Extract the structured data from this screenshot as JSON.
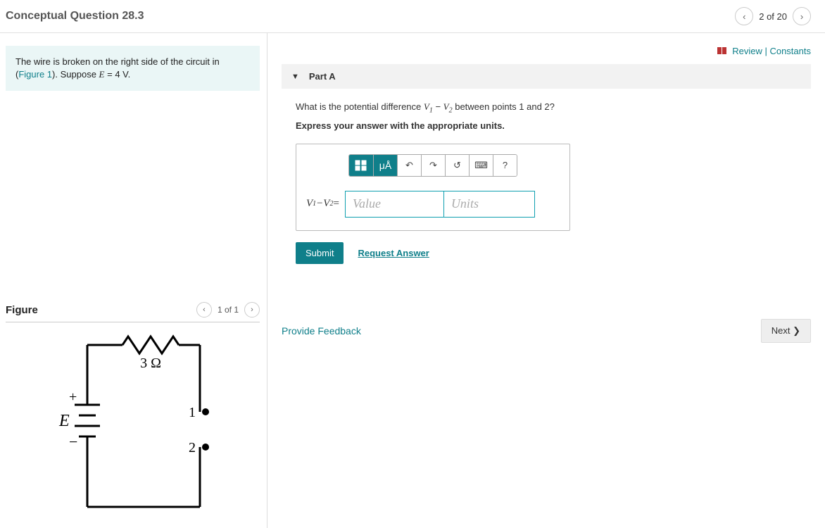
{
  "header": {
    "title": "Conceptual Question 28.3",
    "pager_text": "2 of 20"
  },
  "problem": {
    "text_before_link": "The wire is broken on the right side of the circuit in (",
    "figure_link": "Figure 1",
    "text_after_link": "). Suppose ",
    "emf_symbol": "E",
    "emf_value": " = 4 V",
    "period": "."
  },
  "figure": {
    "title": "Figure",
    "pager": "1 of 1",
    "resistor_label": "3 Ω",
    "emf_label": "E",
    "plus": "+",
    "minus": "−",
    "node1": "1",
    "node2": "2"
  },
  "toplinks": {
    "review": "Review",
    "sep": " | ",
    "constants": "Constants"
  },
  "part": {
    "label": "Part A",
    "question_pre": "What is the potential difference ",
    "v1": "V",
    "sub1": "1",
    "minus": " − ",
    "v2": "V",
    "sub2": "2",
    "question_post": " between points 1 and 2?",
    "instruction": "Express your answer with the appropriate units.",
    "toolbar": {
      "templates": "▫▫",
      "units_btn": "μÅ",
      "undo": "↶",
      "redo": "↷",
      "reset": "↺",
      "keyboard": "⌨",
      "help": "?"
    },
    "answer_label_v1": "V",
    "answer_label_s1": "1",
    "answer_label_minus": " − ",
    "answer_label_v2": "V",
    "answer_label_s2": "2",
    "answer_label_eq": " = ",
    "value_placeholder": "Value",
    "units_placeholder": "Units",
    "submit": "Submit",
    "request": "Request Answer"
  },
  "bottom": {
    "feedback": "Provide Feedback",
    "next": "Next ❯"
  }
}
